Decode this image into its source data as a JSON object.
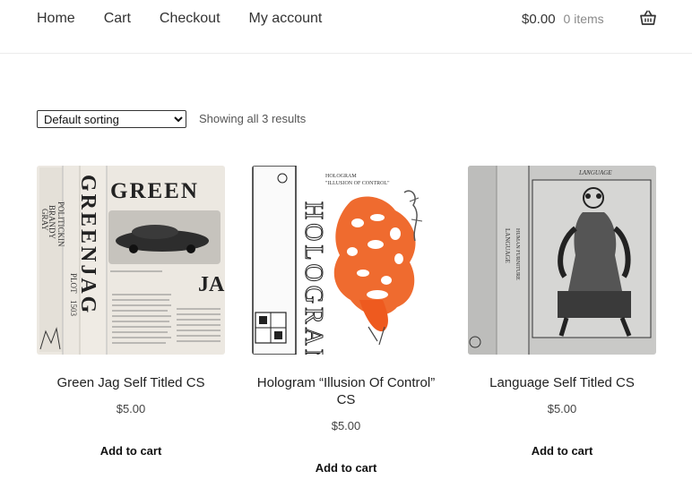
{
  "nav": {
    "items": [
      "Home",
      "Cart",
      "Checkout",
      "My account"
    ]
  },
  "cart": {
    "total": "$0.00",
    "count": "0 items",
    "icon": "basket-icon"
  },
  "toolbar": {
    "sort_selected": "Default sorting",
    "results_text": "Showing all 3 results"
  },
  "products": [
    {
      "title": "Green Jag Self Titled CS",
      "price": "$5.00",
      "add_label": "Add to cart",
      "cover_text": [
        "GREEN",
        "JAG",
        "GREENJAG",
        "BRANDY",
        "POLITICKIN",
        "GRAY",
        "PLOT",
        "1503"
      ]
    },
    {
      "title": "Hologram “Illusion Of Control” CS",
      "price": "$5.00",
      "add_label": "Add to cart",
      "cover_text": [
        "HOLOGRAM",
        "\"ILLUSION OF CONTROL\"",
        "HOLOGRAM"
      ]
    },
    {
      "title": "Language Self Titled CS",
      "price": "$5.00",
      "add_label": "Add to cart",
      "cover_text": [
        "LANGUAGE",
        "LANGUAGE",
        "HUMAN FURNITURE"
      ]
    }
  ]
}
